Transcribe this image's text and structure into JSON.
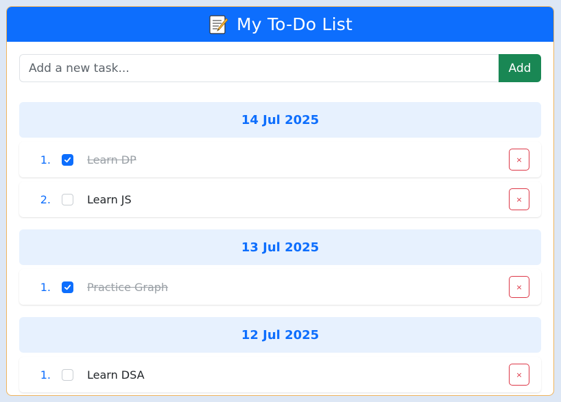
{
  "header": {
    "title": "My To-Do List",
    "icon": "memo-icon"
  },
  "form": {
    "placeholder": "Add a new task...",
    "add_label": "Add"
  },
  "colors": {
    "primary": "#0d6efd",
    "success": "#198754",
    "danger": "#dc3545",
    "date_bg": "#e7f1fe"
  },
  "groups": [
    {
      "date": "14 Jul 2025",
      "tasks": [
        {
          "num": "1.",
          "text": "Learn DP",
          "done": true,
          "delete": "×"
        },
        {
          "num": "2.",
          "text": "Learn JS",
          "done": false,
          "delete": "×"
        }
      ]
    },
    {
      "date": "13 Jul 2025",
      "tasks": [
        {
          "num": "1.",
          "text": "Practice Graph",
          "done": true,
          "delete": "×"
        }
      ]
    },
    {
      "date": "12 Jul 2025",
      "tasks": [
        {
          "num": "1.",
          "text": "Learn DSA",
          "done": false,
          "delete": "×"
        }
      ]
    }
  ]
}
